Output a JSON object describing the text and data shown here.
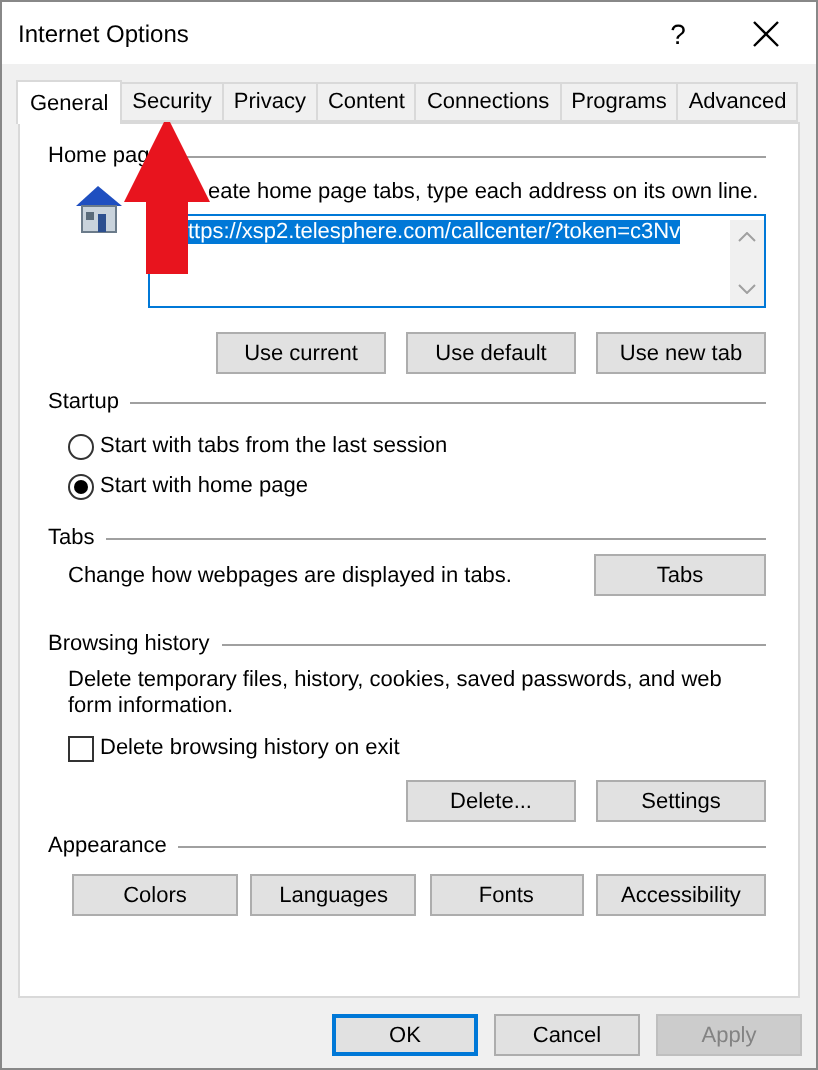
{
  "window": {
    "title": "Internet Options",
    "help": "?"
  },
  "tabs": [
    {
      "label": "General",
      "selected": true
    },
    {
      "label": "Security",
      "selected": false
    },
    {
      "label": "Privacy",
      "selected": false
    },
    {
      "label": "Content",
      "selected": false
    },
    {
      "label": "Connections",
      "selected": false
    },
    {
      "label": "Programs",
      "selected": false
    },
    {
      "label": "Advanced",
      "selected": false
    }
  ],
  "home_page": {
    "label": "Home pag",
    "hint": "eate home page tabs, type each address on its own line.",
    "value": "ttps://xsp2.telesphere.com/callcenter/?token=c3Nv",
    "value_selected": true,
    "buttons": [
      "Use current",
      "Use default",
      "Use new tab"
    ]
  },
  "startup": {
    "label": "Startup",
    "options": [
      {
        "label": "Start with tabs from the last session",
        "selected": false
      },
      {
        "label": "Start with home page",
        "selected": true
      }
    ]
  },
  "tabs_section": {
    "label": "Tabs",
    "description": "Change how webpages are displayed in tabs.",
    "button": "Tabs"
  },
  "browsing_history": {
    "label": "Browsing history",
    "description": "Delete temporary files, history, cookies, saved passwords, and web form information.",
    "checkbox": {
      "label": "Delete browsing history on exit",
      "checked": false
    },
    "buttons": [
      "Delete...",
      "Settings"
    ]
  },
  "appearance": {
    "label": "Appearance",
    "buttons": [
      "Colors",
      "Languages",
      "Fonts",
      "Accessibility"
    ]
  },
  "footer_buttons": [
    {
      "label": "OK",
      "default": true,
      "disabled": false
    },
    {
      "label": "Cancel",
      "default": false,
      "disabled": false
    },
    {
      "label": "Apply",
      "default": false,
      "disabled": true
    }
  ]
}
